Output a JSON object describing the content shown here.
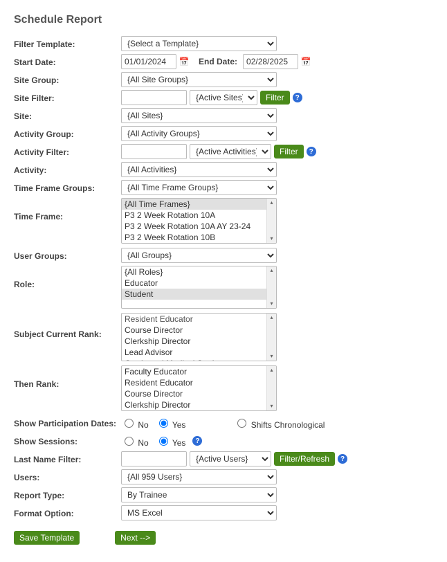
{
  "title": "Schedule Report",
  "labels": {
    "filterTemplate": "Filter Template:",
    "startDate": "Start Date:",
    "endDate": "End Date:",
    "siteGroup": "Site Group:",
    "siteFilter": "Site Filter:",
    "site": "Site:",
    "activityGroup": "Activity Group:",
    "activityFilter": "Activity Filter:",
    "activity": "Activity:",
    "timeFrameGroups": "Time Frame Groups:",
    "timeFrame": "Time Frame:",
    "userGroups": "User Groups:",
    "role": "Role:",
    "subjectCurrentRank": "Subject Current Rank:",
    "thenRank": "Then Rank:",
    "showParticipationDates": "Show Participation Dates:",
    "showSessions": "Show Sessions:",
    "lastNameFilter": "Last Name Filter:",
    "users": "Users:",
    "reportType": "Report Type:",
    "formatOption": "Format Option:"
  },
  "values": {
    "filterTemplate": "{Select a Template}",
    "startDate": "01/01/2024",
    "endDate": "02/28/2025",
    "siteGroup": "{All Site Groups}",
    "siteFilterText": "",
    "siteFilterSelect": "{Active Sites}",
    "site": "{All Sites}",
    "activityGroup": "{All Activity Groups}",
    "activityFilterText": "",
    "activityFilterSelect": "{Active Activities}",
    "activity": "{All Activities}",
    "timeFrameGroups": "{All Time Frame Groups}",
    "userGroups": "{All Groups}",
    "lastNameFilterText": "",
    "lastNameFilterSelect": "{Active Users}",
    "users": "{All 959 Users}",
    "reportType": "By Trainee",
    "formatOption": "MS Excel"
  },
  "lists": {
    "timeFrame": [
      {
        "text": "{All Time Frames}",
        "selected": true
      },
      {
        "text": "P3 2 Week Rotation 10A",
        "selected": false
      },
      {
        "text": "P3 2 Week Rotation 10A AY 23-24",
        "selected": false
      },
      {
        "text": "P3 2 Week Rotation 10B",
        "selected": false
      }
    ],
    "role": [
      {
        "text": "{All Roles}",
        "selected": false
      },
      {
        "text": "Educator",
        "selected": false
      },
      {
        "text": "Student",
        "selected": true
      }
    ],
    "subjectCurrentRank": [
      {
        "text": "Resident Educator",
        "selected": false,
        "truncated": true
      },
      {
        "text": "Course Director",
        "selected": false
      },
      {
        "text": "Clerkship Director",
        "selected": false
      },
      {
        "text": "Lead Advisor",
        "selected": false
      },
      {
        "text": "Graduated Medical Student",
        "selected": false,
        "truncated": true
      }
    ],
    "thenRank": [
      {
        "text": "Faculty Educator",
        "selected": false
      },
      {
        "text": "Resident Educator",
        "selected": false
      },
      {
        "text": "Course Director",
        "selected": false
      },
      {
        "text": "Clerkship Director",
        "selected": false
      }
    ]
  },
  "radios": {
    "participationDates": {
      "no": "No",
      "yes": "Yes",
      "selected": "yes"
    },
    "sessions": {
      "no": "No",
      "yes": "Yes",
      "selected": "yes"
    },
    "shiftsChronological": {
      "label": "Shifts Chronological",
      "checked": false
    }
  },
  "buttons": {
    "filter": "Filter",
    "filterRefresh": "Filter/Refresh",
    "saveTemplate": "Save Template",
    "next": "Next -->"
  },
  "help": "?"
}
